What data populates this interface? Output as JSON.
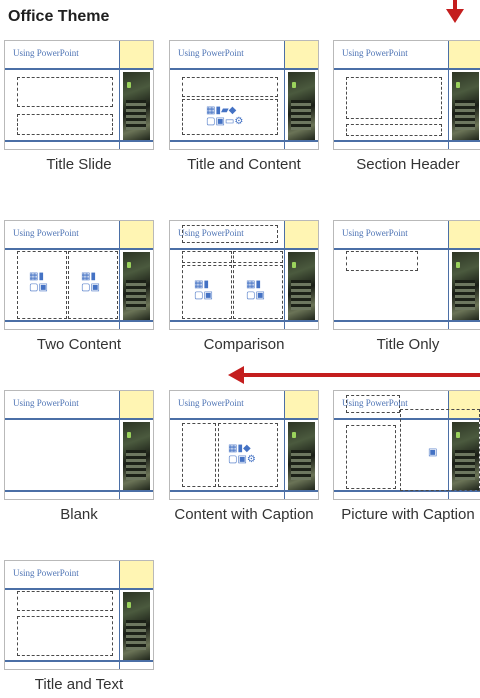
{
  "gallery": {
    "title": "Office Theme",
    "thumbnail_title": "Using PowerPoint",
    "layouts": [
      "Title Slide",
      "Title and Content",
      "Section Header",
      "Two Content",
      "Comparison",
      "Title Only",
      "Blank",
      "Content with Caption",
      "Picture with Caption",
      "Title and Text"
    ]
  },
  "colors": {
    "accent_line": "#4b6fa6",
    "title_text": "#4d73b4",
    "banner_yellow": "#fff5b3",
    "annotation_arrow": "#c41e1e"
  },
  "icons": {
    "content_placeholder": "content-icons",
    "picture_placeholder": "picture-icon",
    "annotation": "red-arrow"
  }
}
